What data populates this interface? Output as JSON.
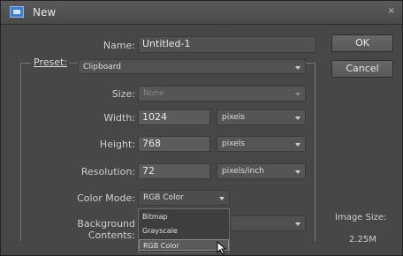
{
  "window": {
    "title": "New",
    "close": "×"
  },
  "form": {
    "name_label": "Name:",
    "name_value": "Untitled-1",
    "preset_label": "Preset:",
    "preset_value": "Clipboard",
    "size_label": "Size:",
    "size_value": "None",
    "width_label": "Width:",
    "width_value": "1024",
    "width_unit": "pixels",
    "height_label": "Height:",
    "height_value": "768",
    "height_unit": "pixels",
    "resolution_label": "Resolution:",
    "resolution_value": "72",
    "resolution_unit": "pixels/inch",
    "color_mode_label": "Color Mode:",
    "color_mode_value": "RGB Color",
    "background_label": "Background Contents:"
  },
  "color_mode_options": [
    "Bitmap",
    "Grayscale",
    "RGB Color"
  ],
  "buttons": {
    "ok": "OK",
    "cancel": "Cancel"
  },
  "image_size": {
    "label": "Image Size:",
    "value": "2.25M"
  }
}
